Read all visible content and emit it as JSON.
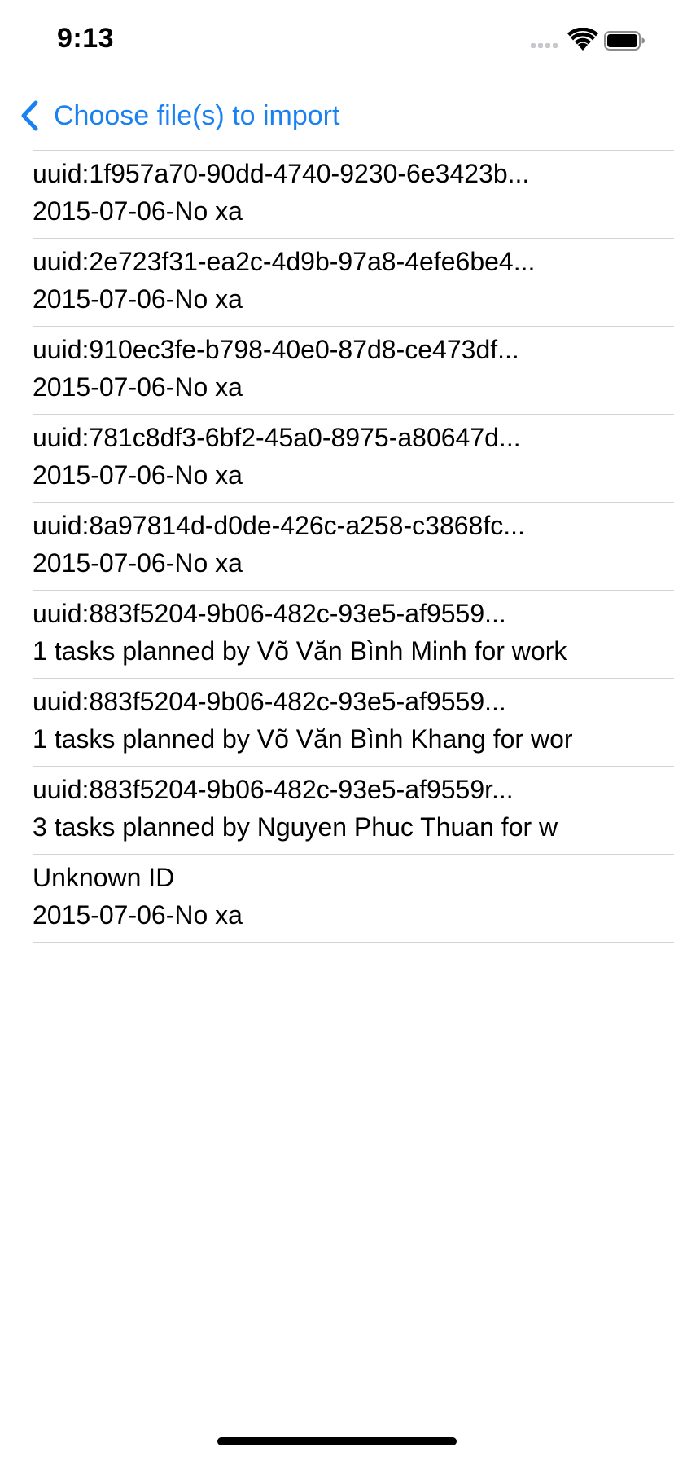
{
  "status_bar": {
    "time": "9:13"
  },
  "nav": {
    "back_label": "Choose file(s) to import"
  },
  "colors": {
    "accent": "#1a82f0",
    "separator": "#d4d4d8"
  },
  "files": [
    {
      "title": "uuid:1f957a70-90dd-4740-9230-6e3423b...",
      "subtitle": "2015-07-06-No xa"
    },
    {
      "title": "uuid:2e723f31-ea2c-4d9b-97a8-4efe6be4...",
      "subtitle": "2015-07-06-No xa"
    },
    {
      "title": "uuid:910ec3fe-b798-40e0-87d8-ce473df...",
      "subtitle": "2015-07-06-No xa"
    },
    {
      "title": "uuid:781c8df3-6bf2-45a0-8975-a80647d...",
      "subtitle": "2015-07-06-No xa"
    },
    {
      "title": "uuid:8a97814d-d0de-426c-a258-c3868fc...",
      "subtitle": "2015-07-06-No xa"
    },
    {
      "title": "uuid:883f5204-9b06-482c-93e5-af9559...",
      "subtitle": "1 tasks planned by Võ Văn Bình Minh for work"
    },
    {
      "title": "uuid:883f5204-9b06-482c-93e5-af9559...",
      "subtitle": "1 tasks planned by Võ Văn Bình Khang for wor"
    },
    {
      "title": "uuid:883f5204-9b06-482c-93e5-af9559r...",
      "subtitle": "3 tasks planned by Nguyen Phuc Thuan for w"
    },
    {
      "title": "Unknown ID",
      "subtitle": "2015-07-06-No xa"
    }
  ]
}
